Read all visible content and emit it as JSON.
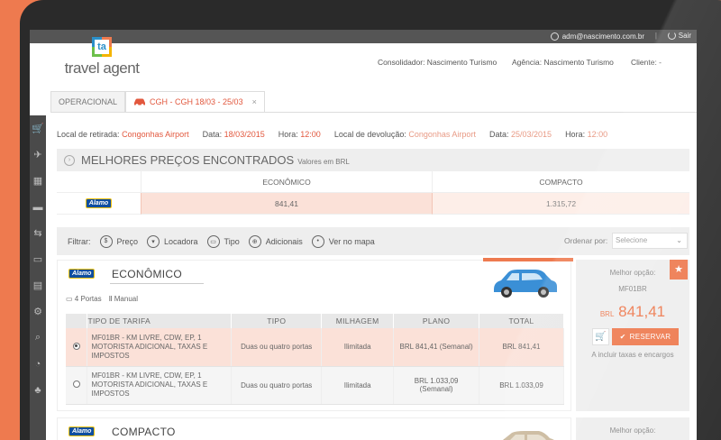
{
  "topbar": {
    "user_email": "adm@nascimento.com.br",
    "separator": "|",
    "logout": "Sair"
  },
  "logo": {
    "mark": "ta",
    "text": "travel agent"
  },
  "header": {
    "consolidador": "Consolidador: Nascimento Turismo",
    "agencia": "Agência: Nascimento Turismo",
    "cliente": "Cliente: -"
  },
  "tabs": [
    {
      "label": "OPERACIONAL"
    },
    {
      "label": "CGH - CGH 18/03 - 25/03",
      "close": "×"
    }
  ],
  "rental": {
    "pickup_label": "Local de retirada:",
    "pickup_value": "Congonhas Airport",
    "date1_label": "Data:",
    "date1_value": "18/03/2015",
    "time1_label": "Hora:",
    "time1_value": "12:00",
    "return_label": "Local de devolução:",
    "return_value": "Congonhas Airport",
    "date2_label": "Data:",
    "date2_value": "25/03/2015",
    "time2_label": "Hora:",
    "time2_value": "12:00"
  },
  "best": {
    "title": "MELHORES PREÇOS ENCONTRADOS",
    "subtitle": "Valores em BRL",
    "columns": [
      "ECONÔMICO",
      "COMPACTO"
    ],
    "company": "Alamo",
    "prices": [
      "841,41",
      "1.315,72"
    ]
  },
  "filters": {
    "label": "Filtrar:",
    "items": [
      "Preço",
      "Locadora",
      "Tipo",
      "Adicionais",
      "Ver no mapa"
    ],
    "order_label": "Ordenar por:",
    "order_value": "Selecione"
  },
  "result": {
    "company": "Alamo",
    "category": "ECONÔMICO",
    "doors": "4 Portas",
    "transmission": "Manual",
    "columns": [
      "TIPO DE TARIFA",
      "TIPO",
      "MILHAGEM",
      "PLANO",
      "TOTAL"
    ],
    "rows": [
      {
        "desc": "MF01BR - KM LIVRE, CDW, EP, 1 MOTORISTA ADICIONAL, TAXAS E IMPOSTOS",
        "tipo": "Duas ou quatro portas",
        "milhagem": "Ilimitada",
        "plano": "BRL 841,41 (Semanal)",
        "total": "BRL 841,41"
      },
      {
        "desc": "MF01BR - KM LIVRE, CDW, EP, 1 MOTORISTA ADICIONAL, TAXAS E IMPOSTOS",
        "tipo": "Duas ou quatro portas",
        "milhagem": "Ilimitada",
        "plano": "BRL 1.033,09 (Semanal)",
        "total": "BRL 1.033,09"
      }
    ]
  },
  "side": {
    "best_option": "Melhor opção:",
    "code": "MF01BR",
    "currency": "BRL",
    "price": "841,41",
    "reserve": "RESERVAR",
    "tax_note": "A incluir taxas e encargos"
  },
  "result2": {
    "company": "Alamo",
    "category": "COMPACTO",
    "best_option": "Melhor opção:"
  },
  "colors": {
    "accent": "#ee7a4f",
    "highlight": "#fbe1d8",
    "dark": "#4a4a4a"
  }
}
